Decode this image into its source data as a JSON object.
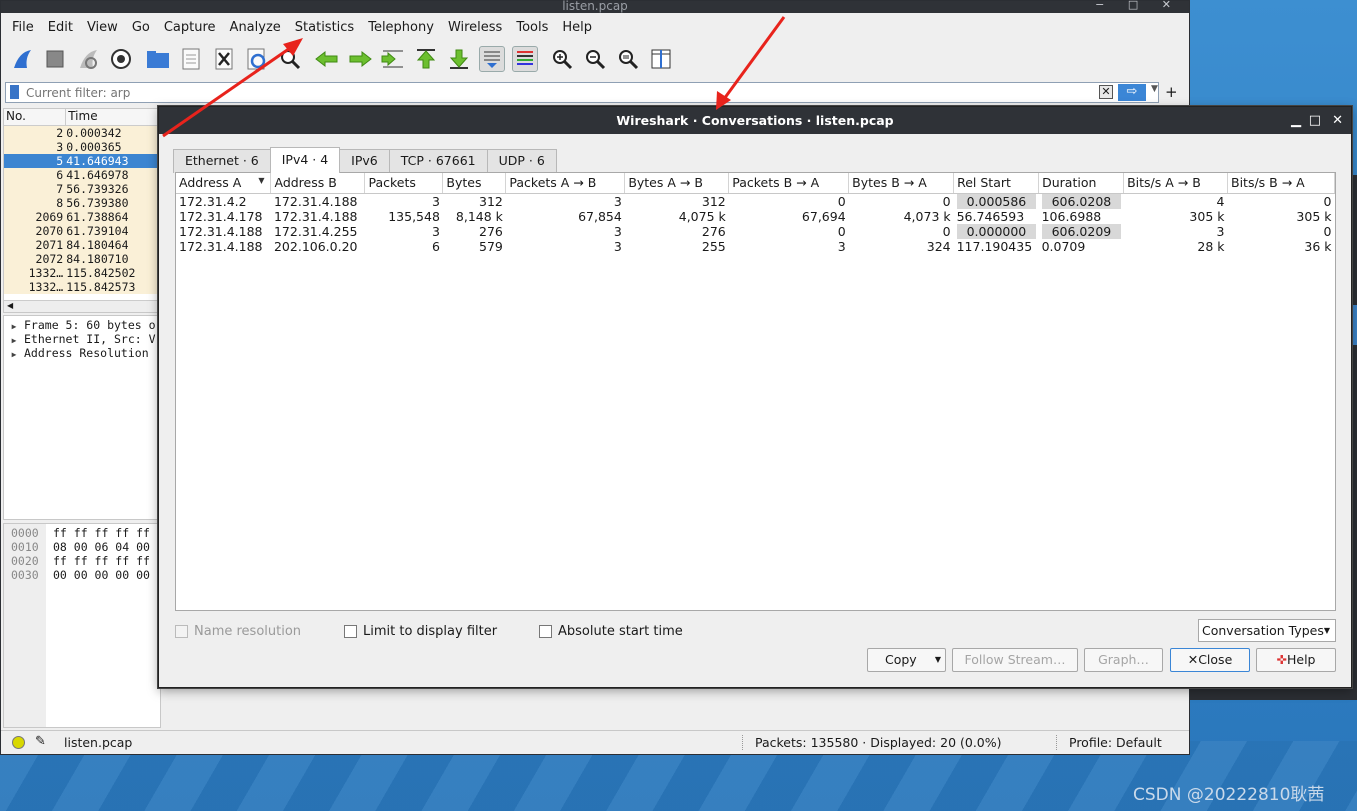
{
  "main_window": {
    "title": "listen.pcap",
    "controls": "− □ ✕"
  },
  "menu": [
    "File",
    "Edit",
    "View",
    "Go",
    "Capture",
    "Analyze",
    "Statistics",
    "Telephony",
    "Wireless",
    "Tools",
    "Help"
  ],
  "toolbar_icons": [
    "shark-fin-icon",
    "stop-icon",
    "restart-icon",
    "options-gear-icon",
    "open-folder-icon",
    "file-icon",
    "close-file-icon",
    "reload-icon",
    "find-icon",
    "go-back-icon",
    "go-forward-icon",
    "go-to-packet-icon",
    "first-packet-icon",
    "last-packet-icon",
    "autoscroll-icon",
    "colorize-icon",
    "zoom-in-icon",
    "zoom-out-icon",
    "zoom-normal-icon",
    "resize-columns-icon"
  ],
  "filter": {
    "placeholder": "Current filter: arp",
    "value": ""
  },
  "packet_list": {
    "columns": [
      "No.",
      "Time"
    ],
    "rows": [
      {
        "no": "2",
        "time": "0.000342"
      },
      {
        "no": "3",
        "time": "0.000365"
      },
      {
        "no": "5",
        "time": "41.646943"
      },
      {
        "no": "6",
        "time": "41.646978"
      },
      {
        "no": "7",
        "time": "56.739326"
      },
      {
        "no": "8",
        "time": "56.739380"
      },
      {
        "no": "2069",
        "time": "61.738864"
      },
      {
        "no": "2070",
        "time": "61.739104"
      },
      {
        "no": "2071",
        "time": "84.180464"
      },
      {
        "no": "2072",
        "time": "84.180710"
      },
      {
        "no": "1332…",
        "time": "115.842502"
      },
      {
        "no": "1332…",
        "time": "115.842573"
      }
    ],
    "selected_no": "5"
  },
  "detail_tree": [
    "Frame 5: 60 bytes o",
    "Ethernet II, Src: V",
    "Address Resolution"
  ],
  "hex": {
    "offsets": [
      "0000",
      "0010",
      "0020",
      "0030"
    ],
    "bytes": [
      "ff ff ff ff ff",
      "08 00 06 04 00",
      "ff ff ff ff ff",
      "00 00 00 00 00"
    ]
  },
  "status": {
    "file": "listen.pcap",
    "packets": "Packets: 135580 · Displayed: 20 (0.0%)",
    "profile": "Profile: Default"
  },
  "dialog": {
    "title": "Wireshark · Conversations · listen.pcap",
    "tabs": [
      "Ethernet · 6",
      "IPv4 · 4",
      "IPv6",
      "TCP · 67661",
      "UDP · 6"
    ],
    "active_tab": "IPv4 · 4",
    "columns": [
      "Address A",
      "Address B",
      "Packets",
      "Bytes",
      "Packets A → B",
      "Bytes A → B",
      "Packets B → A",
      "Bytes B → A",
      "Rel Start",
      "Duration",
      "Bits/s A → B",
      "Bits/s B → A"
    ],
    "rows": [
      [
        "172.31.4.2",
        "172.31.4.188",
        "3",
        "312",
        "3",
        "312",
        "0",
        "0",
        "0.000586",
        "606.0208",
        "4",
        "0"
      ],
      [
        "172.31.4.178",
        "172.31.4.188",
        "135,548",
        "8,148 k",
        "67,854",
        "4,075 k",
        "67,694",
        "4,073 k",
        "56.746593",
        "106.6988",
        "305 k",
        "305 k"
      ],
      [
        "172.31.4.188",
        "172.31.4.255",
        "3",
        "276",
        "3",
        "276",
        "0",
        "0",
        "0.000000",
        "606.0209",
        "3",
        "0"
      ],
      [
        "172.31.4.188",
        "202.106.0.20",
        "6",
        "579",
        "3",
        "255",
        "3",
        "324",
        "117.190435",
        "0.0709",
        "28 k",
        "36 k"
      ]
    ],
    "options": {
      "name_resolution": "Name resolution",
      "limit_filter": "Limit to display filter",
      "absolute_start": "Absolute start time"
    },
    "conversation_types": "Conversation Types",
    "buttons": {
      "copy": "Copy",
      "follow": "Follow Stream…",
      "graph": "Graph…",
      "close": "Close",
      "help": "Help"
    }
  },
  "watermark": "CSDN @20222810耿茜",
  "colors": {
    "title_bar": "#2f3237",
    "selection": "#3c85d1",
    "packet_bg": "#faf0d7",
    "annotation_arrow": "#e8231c",
    "desktop": "#3d8fd1"
  }
}
